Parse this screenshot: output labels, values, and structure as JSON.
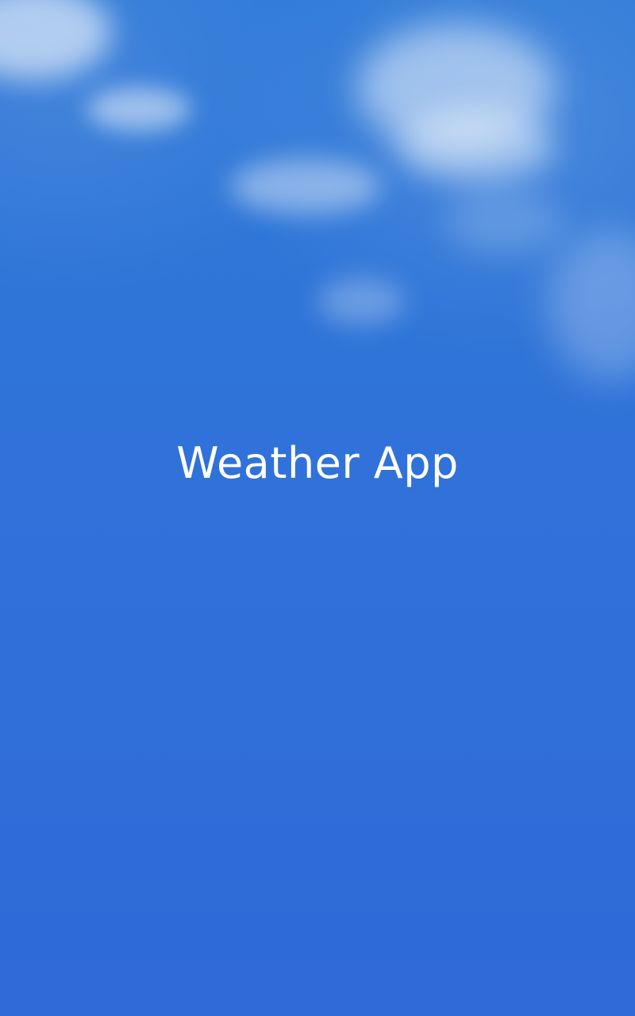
{
  "app": {
    "title": "Weather App"
  },
  "background": {
    "image": "sky-with-clouds",
    "color": "#2f72d8"
  }
}
